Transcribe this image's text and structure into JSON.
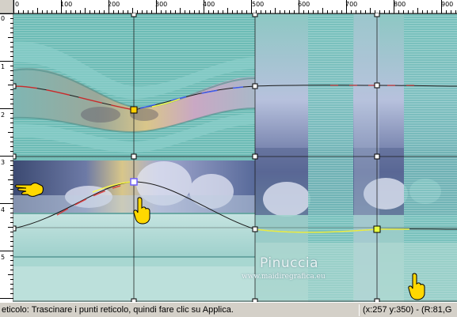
{
  "ruler": {
    "top_labels": [
      "0",
      "100",
      "200",
      "300",
      "400",
      "500",
      "600",
      "700",
      "800",
      "900"
    ],
    "left_labels": [
      "0",
      "1",
      "2",
      "3",
      "4",
      "5"
    ]
  },
  "watermark": {
    "name": "Pinuccia",
    "url": "www.maidiregrafica.eu"
  },
  "statusbar": {
    "message": "eticolo: Trascinare i punti reticolo, quindi fare clic su Applica.",
    "coords": "(x:257 y:350) - (R:81,G"
  },
  "colors": {
    "grid_line": "#1a1a1a",
    "curve_red": "#e03030",
    "curve_yellow": "#ffff40",
    "handle_hand": "#ffd800"
  },
  "icons": [
    "pointing-hand-icon"
  ]
}
